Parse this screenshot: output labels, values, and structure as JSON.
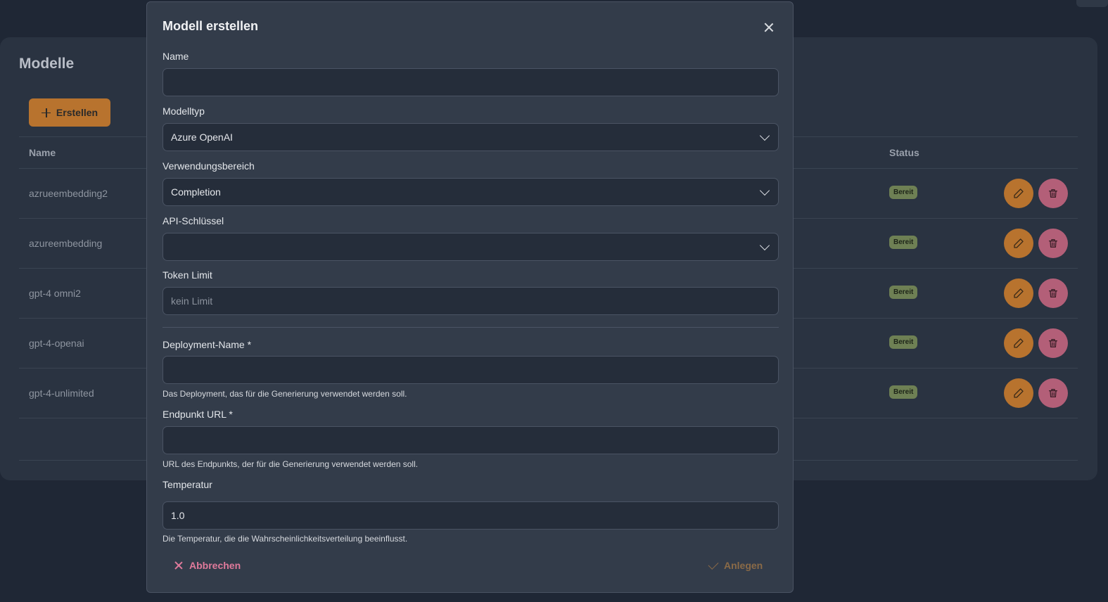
{
  "page": {
    "title": "Modelle",
    "create_button": "Erstellen",
    "table": {
      "columns": {
        "name": "Name",
        "status": "Status"
      },
      "rows": [
        {
          "name": "azrueembedding2",
          "status": "Bereit"
        },
        {
          "name": "azureembedding",
          "status": "Bereit"
        },
        {
          "name": "gpt-4 omni2",
          "status": "Bereit"
        },
        {
          "name": "gpt-4-openai",
          "status": "Bereit"
        },
        {
          "name": "gpt-4-unlimited",
          "status": "Bereit"
        }
      ]
    }
  },
  "dialog": {
    "title": "Modell erstellen",
    "fields": {
      "name": {
        "label": "Name",
        "value": ""
      },
      "model_type": {
        "label": "Modelltyp",
        "value": "Azure OpenAI"
      },
      "usage": {
        "label": "Verwendungsbereich",
        "value": "Completion"
      },
      "api_key": {
        "label": "API-Schlüssel",
        "value": ""
      },
      "token_limit": {
        "label": "Token Limit",
        "value": "",
        "placeholder": "kein Limit"
      },
      "deployment_name": {
        "label": "Deployment-Name *",
        "value": "",
        "hint": "Das Deployment, das für die Generierung verwendet werden soll."
      },
      "endpoint_url": {
        "label": "Endpunkt URL *",
        "value": "",
        "hint": "URL des Endpunkts, der für die Generierung verwendet werden soll."
      },
      "temperature": {
        "label": "Temperatur",
        "value": "1.0",
        "hint": "Die Temperatur, die die Wahrscheinlichkeitsverteilung beeinflusst."
      }
    },
    "cancel_label": "Abbrechen",
    "submit_label": "Anlegen"
  },
  "icons": {
    "plus": "plus-icon",
    "edit": "pencil-icon",
    "delete": "trash-icon",
    "close": "close-icon",
    "chevron": "chevron-down-icon",
    "cancel": "x-icon",
    "submit": "check-icon"
  },
  "colors": {
    "background": "#1f2735",
    "card": "#2a3341",
    "modal": "#333c4a",
    "accent_orange": "#b8732e",
    "accent_pink": "#b35f78",
    "status_ready": "#6e8054",
    "cancel_text": "#e07a9b"
  }
}
